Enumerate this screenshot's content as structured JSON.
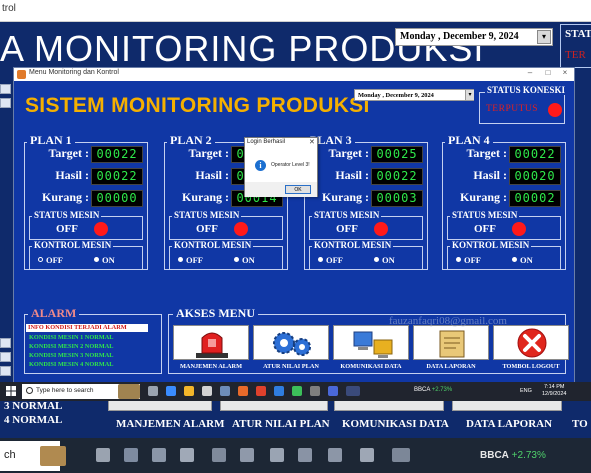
{
  "background": {
    "strip_text": "trol",
    "title": "A MONITORING PRODUKSI",
    "date": "Monday  , December   9, 2024",
    "status_fragment_1": "STAT",
    "status_fragment_2": "TER",
    "kondisi_lines": [
      "3 NORMAL",
      "4 NORMAL"
    ],
    "menu_labels": [
      "MANJEMEN ALARM",
      "ATUR NILAI PLAN",
      "KOMUNIKASI DATA",
      "DATA LAPORAN",
      "TO"
    ],
    "taskbar_search": "ch",
    "taskbar_stock_name": "BBCA",
    "taskbar_stock_change": "+2.73%"
  },
  "window": {
    "title": "Menu Monitoring dan Kontrol",
    "header": "SISTEM MONITORING PRODUKSI",
    "date": "Monday  , December   9, 2024",
    "status": {
      "label": "STATUS KONESKI",
      "value": "TERPUTUS",
      "led_color": "#ff1a1a"
    },
    "plans": [
      {
        "label": "PLAN 1",
        "target": "00022",
        "hasil": "00022",
        "kurang": "00000",
        "mesin": "OFF",
        "kontrol": "OFF",
        "kontrol_on": "ON"
      },
      {
        "label": "PLAN 2",
        "target": "00022",
        "hasil": "00008",
        "kurang": "00014",
        "mesin": "OFF",
        "kontrol": "OFF",
        "kontrol_on": "ON"
      },
      {
        "label": "PLAN 3",
        "target": "00025",
        "hasil": "00022",
        "kurang": "00003",
        "mesin": "OFF",
        "kontrol": "OFF",
        "kontrol_on": "ON"
      },
      {
        "label": "PLAN 4",
        "target": "00022",
        "hasil": "00020",
        "kurang": "00002",
        "mesin": "OFF",
        "kontrol": "OFF",
        "kontrol_on": "ON"
      }
    ],
    "labels": {
      "target": "Target :",
      "hasil": "Hasil :",
      "kurang": "Kurang :",
      "status_mesin": "STATUS MESIN",
      "kontrol_mesin": "KONTROL MESIN"
    },
    "alarm": {
      "label": "ALARM",
      "info": "INFO KONDISI TERJADI ALARM",
      "lines": [
        "KONDISI MESIN 1 NORMAL",
        "KONDISI MESIN 2 NORMAL",
        "KONDISI MESIN 3 NORMAL",
        "KONDISI MESIN 4 NORMAL"
      ]
    },
    "akses": {
      "label": "AKSES MENU",
      "items": [
        {
          "label": "MANJEMEN ALARM",
          "icon": "siren-icon"
        },
        {
          "label": "ATUR NILAI PLAN",
          "icon": "gears-icon"
        },
        {
          "label": "KOMUNIKASI DATA",
          "icon": "computer-network-icon"
        },
        {
          "label": "DATA LAPORAN",
          "icon": "report-book-icon"
        },
        {
          "label": "TOMBOL LOGOUT",
          "icon": "logout-x-icon"
        }
      ]
    },
    "watermark": "fauzanfaqri08@gmail.com"
  },
  "dialog": {
    "title": "Login Berhasil",
    "message": "Operator Level 3!",
    "ok": "OK"
  },
  "taskbar": {
    "search_placeholder": "Type here to search",
    "stock_name": "BBCA",
    "stock_change": "+2.73%",
    "lang": "ENG",
    "time": "7:14 PM",
    "date": "12/9/2024"
  },
  "colors": {
    "panel_blue": "#1037a5",
    "title_gold": "#f5b000",
    "digit_green": "#2ee84a",
    "led_red": "#ff1a1a"
  }
}
